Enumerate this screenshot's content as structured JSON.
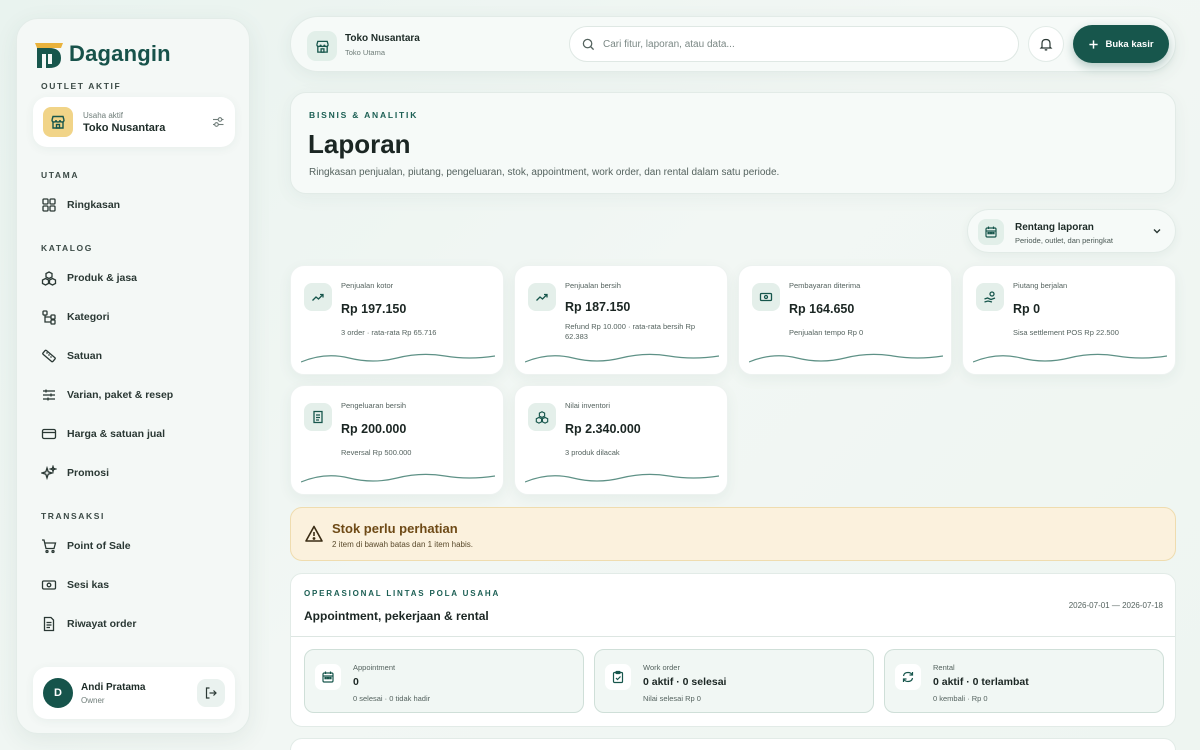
{
  "brand": {
    "name": "Dagangin"
  },
  "sidebar": {
    "outlet_section": "OUTLET AKTIF",
    "outlet": {
      "small_label": "Usaha aktif",
      "name": "Toko Nusantara"
    },
    "sections": {
      "utama": "UTAMA",
      "katalog": "KATALOG",
      "transaksi": "TRANSAKSI"
    },
    "items": {
      "ringkasan": "Ringkasan",
      "produk": "Produk & jasa",
      "kategori": "Kategori",
      "satuan": "Satuan",
      "varian": "Varian, paket & resep",
      "harga": "Harga & satuan jual",
      "promosi": "Promosi",
      "pos": "Point of Sale",
      "sesi_kas": "Sesi kas",
      "riwayat": "Riwayat order"
    },
    "user": {
      "initial": "D",
      "name": "Andi Pratama",
      "role": "Owner"
    }
  },
  "header": {
    "store_name": "Toko Nusantara",
    "store_sub": "Toko Utama",
    "search_placeholder": "Cari fitur, laporan, atau data...",
    "cashier_button": "Buka kasir"
  },
  "hero": {
    "eyebrow": "BISNIS & ANALITIK",
    "title": "Laporan",
    "description": "Ringkasan penjualan, piutang, pengeluaran, stok, appointment, work order, dan rental dalam satu periode."
  },
  "range": {
    "title": "Rentang laporan",
    "subtitle": "Periode, outlet, dan peringkat"
  },
  "kpis": [
    {
      "label": "Penjualan kotor",
      "value": "Rp 197.150",
      "note": "3 order · rata-rata Rp 65.716",
      "icon": "trend-up-icon"
    },
    {
      "label": "Penjualan bersih",
      "value": "Rp 187.150",
      "note": "Refund Rp 10.000 · rata-rata bersih Rp 62.383",
      "icon": "trend-up-icon"
    },
    {
      "label": "Pembayaran diterima",
      "value": "Rp 164.650",
      "note": "Penjualan tempo Rp 0",
      "icon": "cash-icon"
    },
    {
      "label": "Piutang berjalan",
      "value": "Rp 0",
      "note": "Sisa settlement POS Rp 22.500",
      "icon": "hand-coin-icon"
    },
    {
      "label": "Pengeluaran bersih",
      "value": "Rp 200.000",
      "note": "Reversal Rp 500.000",
      "icon": "receipt-icon"
    },
    {
      "label": "Nilai inventori",
      "value": "Rp 2.340.000",
      "note": "3 produk dilacak",
      "icon": "boxes-icon"
    }
  ],
  "alert": {
    "title": "Stok perlu perhatian",
    "description": "2 item di bawah batas dan 1 item habis."
  },
  "ops": {
    "eyebrow": "OPERASIONAL LINTAS POLA USAHA",
    "title": "Appointment, pekerjaan & rental",
    "range": "2026-07-01 — 2026-07-18",
    "cards": [
      {
        "label": "Appointment",
        "value": "0",
        "note": "0 selesai · 0 tidak hadir",
        "icon": "calendar-icon"
      },
      {
        "label": "Work order",
        "value": "0 aktif · 0 selesai",
        "note": "Nilai selesai Rp 0",
        "icon": "clipboard-check-icon"
      },
      {
        "label": "Rental",
        "value": "0 aktif · 0 terlambat",
        "note": "0 kembali · Rp 0",
        "icon": "refresh-icon"
      }
    ]
  },
  "colors": {
    "primary": "#17564c",
    "accent_gold": "#f1d488",
    "alert_bg": "#fbf1dd"
  }
}
